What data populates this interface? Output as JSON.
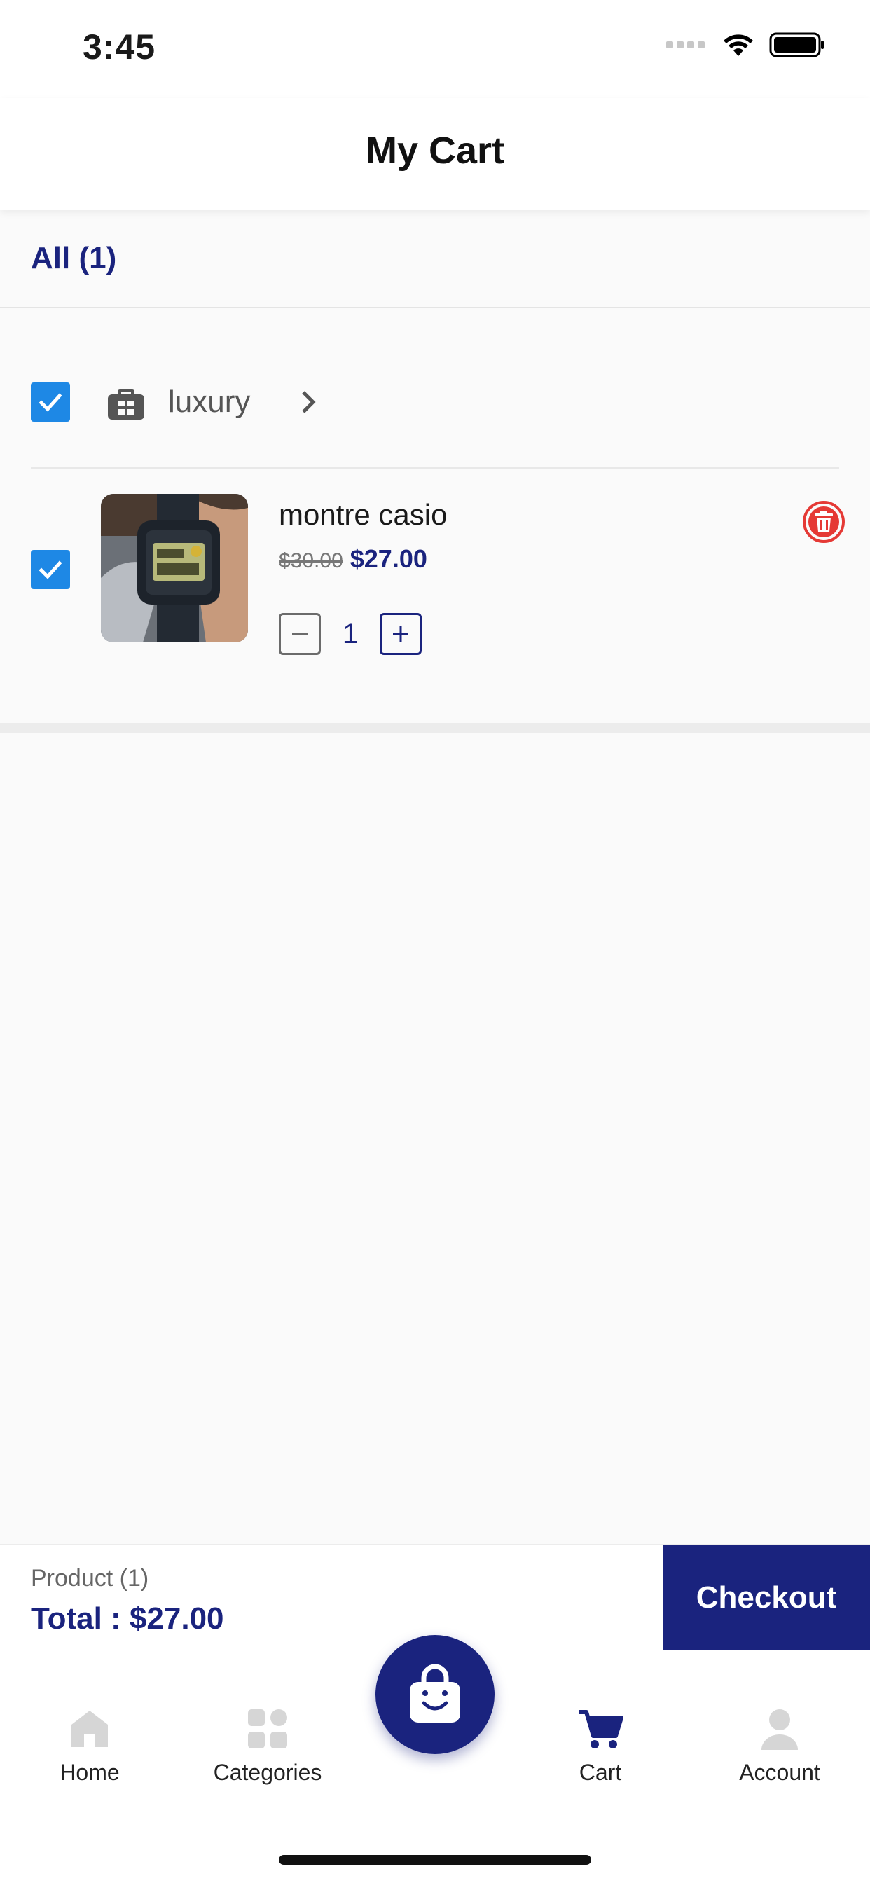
{
  "status_bar": {
    "time": "3:45"
  },
  "header": {
    "title": "My Cart"
  },
  "select_all": {
    "label": "All (1)"
  },
  "shop": {
    "name": "luxury"
  },
  "item": {
    "title": "montre casio",
    "old_price": "$30.00",
    "price": "$27.00",
    "quantity": "1"
  },
  "summary": {
    "product_count": "Product (1)",
    "total": "Total : $27.00",
    "checkout_label": "Checkout"
  },
  "tabs": [
    {
      "label": "Home",
      "icon": "home-icon"
    },
    {
      "label": "Categories",
      "icon": "grid-icon"
    },
    {
      "label": "Cart",
      "icon": "cart-icon",
      "active": true
    },
    {
      "label": "Account",
      "icon": "person-icon"
    }
  ],
  "colors": {
    "primary": "#1a237e",
    "checkbox": "#1e88e5",
    "delete": "#e53935",
    "inactive_icon": "#d6d6d6"
  }
}
